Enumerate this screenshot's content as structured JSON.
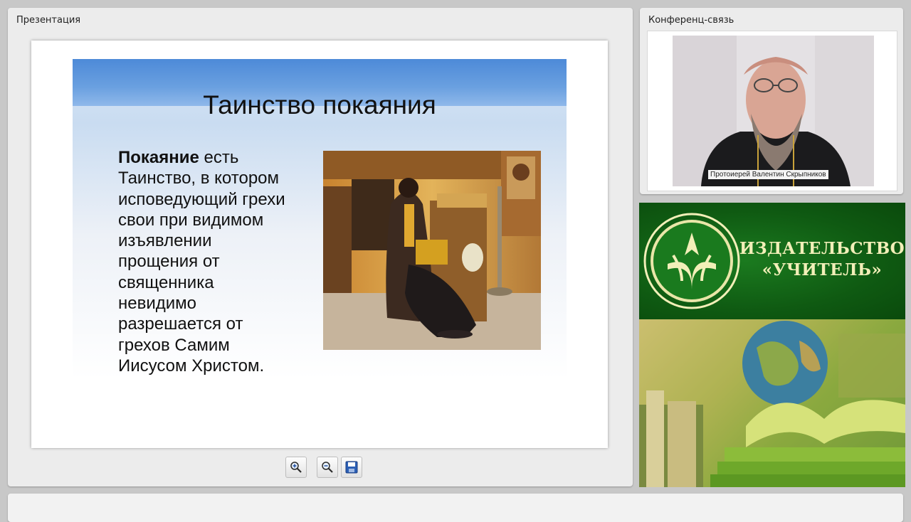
{
  "presentation": {
    "panel_title": "Презентация",
    "slide": {
      "title": "Таинство покаяния",
      "text_bold": "Покаяние",
      "text_lines": [
        " есть",
        "Таинство, в котором",
        "исповедующий грехи",
        "свои при видимом",
        "изъявлении",
        "прощения от",
        "священника",
        "невидимо",
        "разрешается от",
        "грехов Самим",
        "Иисусом Христом."
      ]
    },
    "toolbar": {
      "zoom_in_icon": "zoom-in-icon",
      "zoom_out_icon": "zoom-out-icon",
      "save_icon": "save-icon"
    }
  },
  "conference": {
    "panel_title": "Конференц-связь",
    "speaker_name": "Протоиерей Валентин Скрыпников"
  },
  "publisher": {
    "name_line1": "ИЗДАТЕЛЬСТВО",
    "name_line2": "«УЧИТЕЛЬ»"
  },
  "colors": {
    "slide_band": "#4d8ad8",
    "publisher_green": "#0f5a12",
    "publisher_text": "#f2efb8"
  }
}
